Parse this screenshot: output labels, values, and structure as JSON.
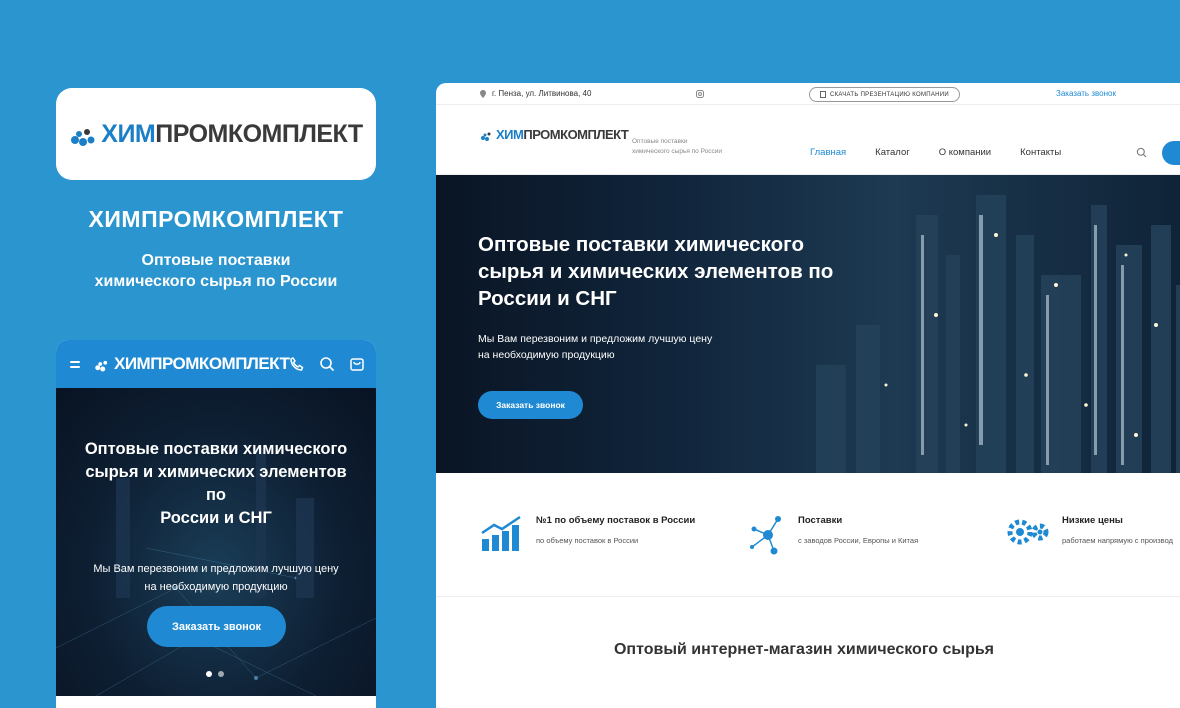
{
  "brand": {
    "logo_part1": "ХИМ",
    "logo_part2": "ПРОМКОМПЛЕКТ",
    "title": "ХИМПРОМКОМПЛЕКТ",
    "subtitle_line1": "Оптовые поставки",
    "subtitle_line2": "химического сырья по России",
    "tagline_line1": "Оптовые поставки",
    "tagline_line2": "химического сырья по России"
  },
  "colors": {
    "accent": "#1f8ad3",
    "background": "#2b95cf"
  },
  "topbar": {
    "address": "г. Пенза, ул. Литвинова, 40",
    "presentation_label": "СКАЧАТЬ ПРЕЗЕНТАЦИЮ КОМПАНИИ",
    "call_label": "Заказать звонок"
  },
  "nav": {
    "items": [
      "Главная",
      "Каталог",
      "О компании",
      "Контакты"
    ]
  },
  "hero": {
    "title_line1": "Оптовые поставки химического",
    "title_line2": "сырья и химических элементов по",
    "title_line3": "России и СНГ",
    "sub_line1": "Мы Вам перезвоним и предложим лучшую цену",
    "sub_line2": "на необходимую продукцию",
    "button": "Заказать звонок"
  },
  "mobile": {
    "title_line1": "Оптовые поставки химического",
    "title_line2": "сырья и химических элементов по",
    "title_line3": "России и СНГ",
    "sub_line1": "Мы Вам перезвоним и предложим лучшую цену",
    "sub_line2": "на необходимую продукцию",
    "button": "Заказать звонок",
    "icons": [
      "menu-icon",
      "phone-icon",
      "search-icon",
      "cart-icon"
    ]
  },
  "features": [
    {
      "icon": "chart-icon",
      "title": "№1 по объему поставок в России",
      "text": "по объему поставок в России"
    },
    {
      "icon": "molecule-icon",
      "title": "Поставки",
      "text": "с заводов России, Европы и Китая"
    },
    {
      "icon": "gears-icon",
      "title": "Низкие цены",
      "text": "работаем напрямую с производ"
    }
  ],
  "shop_title": "Оптовый интернет-магазин химического сырья"
}
